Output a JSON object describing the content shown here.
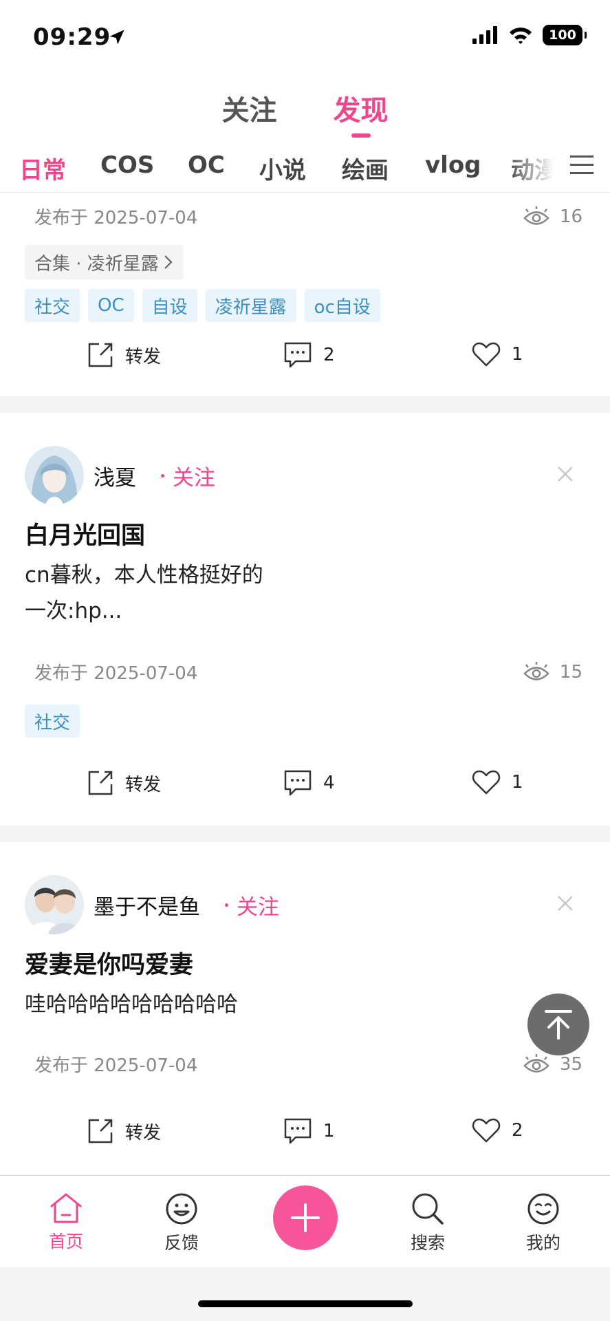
{
  "status": {
    "time": "09:29",
    "battery": "100"
  },
  "top_tabs": [
    {
      "label": "关注",
      "active": false
    },
    {
      "label": "发现",
      "active": true
    }
  ],
  "categories": [
    "日常",
    "COS",
    "OC",
    "小说",
    "绘画",
    "vlog",
    "动漫"
  ],
  "active_category": "日常",
  "posts": [
    {
      "date": "发布于 2025-07-04",
      "views": "16",
      "collection": "合集 · 凌祈星露",
      "tags": [
        "社交",
        "OC",
        "自设",
        "凌祈星露",
        "oc自设"
      ],
      "share_label": "转发",
      "comments": "2",
      "likes": "1"
    },
    {
      "author": "浅夏",
      "follow_label": "关注",
      "title": "白月光回国",
      "body_line1": "cn暮秋，本人性格挺好的",
      "body_line2": "一次:hp...",
      "date": "发布于 2025-07-04",
      "views": "15",
      "tags": [
        "社交"
      ],
      "share_label": "转发",
      "comments": "4",
      "likes": "1"
    },
    {
      "author": "墨于不是鱼",
      "follow_label": "关注",
      "title": "爱妻是你吗爱妻",
      "body_line1": "哇哈哈哈哈哈哈哈哈哈",
      "date": "发布于 2025-07-04",
      "views": "35",
      "share_label": "转发",
      "comments": "1",
      "likes": "2"
    }
  ],
  "bottom_nav": [
    {
      "label": "首页",
      "icon": "home-icon",
      "active": true
    },
    {
      "label": "反馈",
      "icon": "smile-icon",
      "active": false
    },
    {
      "label": "",
      "icon": "plus-icon",
      "active": false
    },
    {
      "label": "搜索",
      "icon": "search-icon",
      "active": false
    },
    {
      "label": "我的",
      "icon": "profile-face-icon",
      "active": false
    }
  ],
  "colors": {
    "accent": "#f0468e",
    "tag_bg": "#eaf5fb",
    "tag_text": "#3b8fc2",
    "separator": "#f4f4f4"
  }
}
